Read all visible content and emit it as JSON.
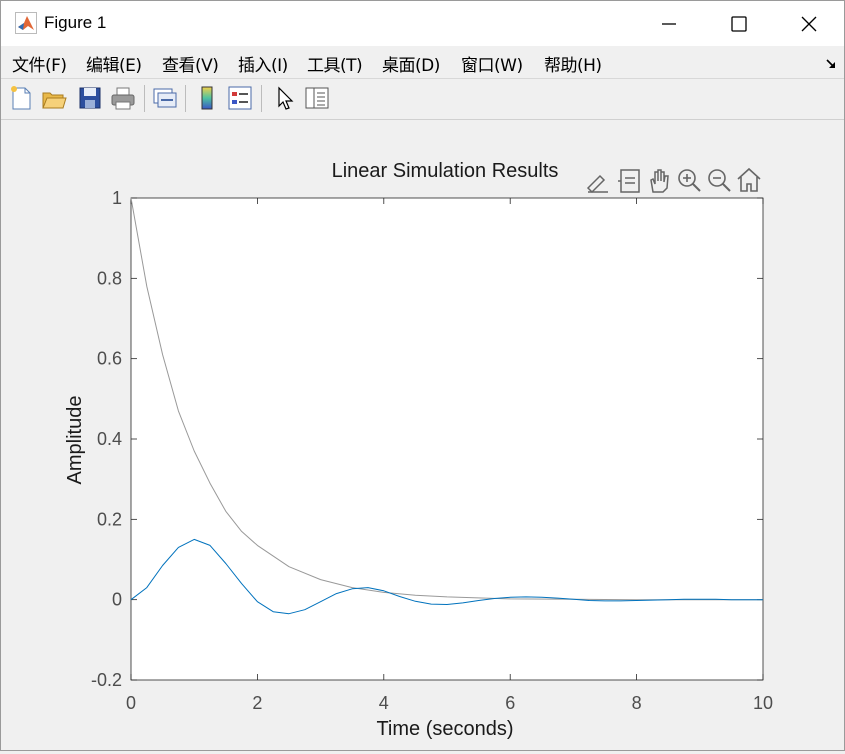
{
  "window": {
    "title": "Figure 1"
  },
  "menubar": {
    "items": [
      "文件(F)",
      "编辑(E)",
      "查看(V)",
      "插入(I)",
      "工具(T)",
      "桌面(D)",
      "窗口(W)",
      "帮助(H)"
    ]
  },
  "toolbar": {
    "buttons": [
      "new-figure-icon",
      "open-file-icon",
      "save-icon",
      "print-icon",
      "link-plot-icon",
      "colorbar-icon",
      "legend-icon",
      "edit-plot-arrow-icon",
      "property-inspector-icon"
    ]
  },
  "axes_toolbar": {
    "buttons": [
      "brush-icon",
      "data-tips-icon",
      "pan-hand-icon",
      "zoom-in-icon",
      "zoom-out-icon",
      "home-icon"
    ]
  },
  "chart_data": {
    "type": "line",
    "title": "Linear Simulation Results",
    "xlabel": "Time (seconds)",
    "ylabel": "Amplitude",
    "xlim": [
      0,
      10
    ],
    "ylim": [
      -0.2,
      1
    ],
    "xticks": [
      "0",
      "2",
      "4",
      "6",
      "8",
      "10"
    ],
    "yticks": [
      "-0.2",
      "0",
      "0.2",
      "0.4",
      "0.6",
      "0.8",
      "1"
    ],
    "grid": false,
    "series": [
      {
        "color": "#999999",
        "x": [
          0,
          0.25,
          0.5,
          0.75,
          1,
          1.25,
          1.5,
          1.75,
          2,
          2.5,
          3,
          3.5,
          4,
          4.5,
          5,
          6,
          7,
          8,
          9,
          10
        ],
        "values": [
          1,
          0.78,
          0.61,
          0.47,
          0.37,
          0.29,
          0.22,
          0.17,
          0.135,
          0.082,
          0.05,
          0.03,
          0.018,
          0.011,
          0.007,
          0.002,
          0.001,
          0,
          0,
          0
        ]
      },
      {
        "color": "#0072BD",
        "x": [
          0,
          0.25,
          0.5,
          0.75,
          1,
          1.25,
          1.5,
          1.75,
          2,
          2.25,
          2.5,
          2.75,
          3,
          3.25,
          3.5,
          3.75,
          4,
          4.25,
          4.5,
          4.75,
          5,
          5.25,
          5.5,
          5.75,
          6,
          6.25,
          6.5,
          6.75,
          7,
          7.25,
          7.5,
          7.75,
          8,
          8.25,
          8.5,
          8.75,
          9,
          9.25,
          9.5,
          9.75,
          10
        ],
        "values": [
          0,
          0.03,
          0.085,
          0.13,
          0.15,
          0.135,
          0.09,
          0.04,
          -0.005,
          -0.03,
          -0.035,
          -0.025,
          -0.005,
          0.015,
          0.027,
          0.03,
          0.022,
          0.008,
          -0.004,
          -0.011,
          -0.012,
          -0.008,
          -0.002,
          0.003,
          0.006,
          0.007,
          0.006,
          0.004,
          0.001,
          -0.002,
          -0.003,
          -0.003,
          -0.002,
          -0.001,
          0,
          0.001,
          0.001,
          0.001,
          0,
          0,
          0
        ]
      }
    ]
  }
}
